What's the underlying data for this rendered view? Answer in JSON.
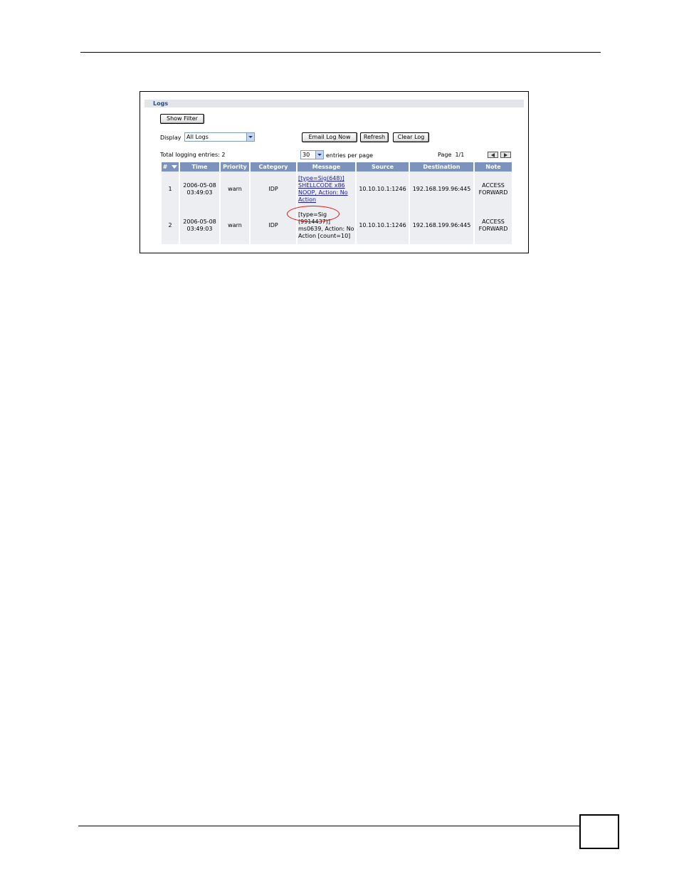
{
  "section_title": "Logs",
  "show_filter_label": "Show Filter",
  "display": {
    "label": "Display",
    "selected": "All Logs"
  },
  "buttons": {
    "email": "Email Log Now",
    "refresh": "Refresh",
    "clear": "Clear Log"
  },
  "total_text": "Total logging entries: 2",
  "per_page": {
    "value": "30",
    "label": "entries per page"
  },
  "page_text": "Page  1/1",
  "columns": [
    "#",
    "Time",
    "Priority",
    "Category",
    "Message",
    "Source",
    "Destination",
    "Note"
  ],
  "rows": [
    {
      "num": "1",
      "time_line1": "2006-05-08",
      "time_line2": "03:49:03",
      "priority": "warn",
      "category": "IDP",
      "message": "[type=Sig(648)] SHELLCODE x86 NOOP, Action: No Action",
      "source": "10.10.10.1:1246",
      "destination": "192.168.199.96:445",
      "note_line1": "ACCESS",
      "note_line2": "FORWARD"
    },
    {
      "num": "2",
      "time_line1": "2006-05-08",
      "time_line2": "03:49:03",
      "priority": "warn",
      "category": "IDP",
      "message": "[type=Sig (9914437)] ms0639, Action: No Action [count=10]",
      "source": "10.10.10.1:1246",
      "destination": "192.168.199.96:445",
      "note_line1": "ACCESS",
      "note_line2": "FORWARD"
    }
  ],
  "icons": {
    "sort": "sort-down-icon",
    "dropdown": "chevron-down-icon",
    "prev": "arrow-left-icon",
    "next": "arrow-right-icon"
  },
  "colors": {
    "header_bg": "#7b93bd",
    "section_bar_bg": "#e2e6ea",
    "section_title": "#2b4a86",
    "row_bg": "#eceef1",
    "link": "#1a1aa6",
    "highlight": "#e01010"
  }
}
